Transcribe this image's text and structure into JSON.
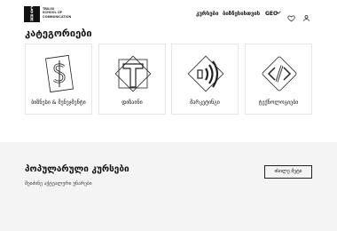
{
  "header": {
    "logo_letters": [
      "C",
      "O",
      "M",
      "M"
    ],
    "logo_text": [
      "TBILISI",
      "SCHOOL OF",
      "COMMUNICATION"
    ],
    "nav": {
      "courses": "კურსები",
      "business": "ბიზნესისთვის"
    },
    "language": "GEO",
    "icons": [
      "chevron-down-icon",
      "heart-icon",
      "user-icon"
    ]
  },
  "categories": {
    "title": "კატეგორიები",
    "items": [
      {
        "label": "ბიზნესი & მენეჯმენტი",
        "icon": "dollar-sign-icon"
      },
      {
        "label": "დიზაინი",
        "icon": "letter-t-icon"
      },
      {
        "label": "მარკეტინგი",
        "icon": "broadcast-icon"
      },
      {
        "label": "ტექნოლოგიები",
        "icon": "code-slash-icon"
      }
    ]
  },
  "popular": {
    "title": "პოპულარული კურსები",
    "subtitle": "შეიძინე აქტუალური უნარები",
    "see_all": "ისილე მეტი"
  }
}
